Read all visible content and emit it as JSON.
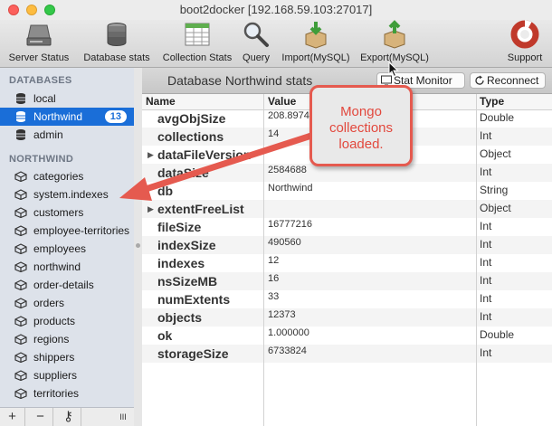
{
  "window": {
    "title": "boot2docker [192.168.59.103:27017]"
  },
  "toolbar": {
    "items": [
      {
        "label": "Server Status",
        "icon": "server-icon"
      },
      {
        "label": "Database stats",
        "icon": "database-icon"
      },
      {
        "label": "Collection Stats",
        "icon": "table-icon"
      },
      {
        "label": "Query",
        "icon": "magnifier-icon"
      },
      {
        "label": "Import(MySQL)",
        "icon": "import-box-icon"
      },
      {
        "label": "Export(MySQL)",
        "icon": "export-box-icon"
      },
      {
        "label": "Support",
        "icon": "lifebuoy-icon"
      }
    ]
  },
  "sidebar": {
    "databases_header": "DATABASES",
    "databases": [
      {
        "label": "local"
      },
      {
        "label": "Northwind",
        "badge": "13",
        "selected": true
      },
      {
        "label": "admin"
      }
    ],
    "collections_header": "NORTHWIND",
    "collections": [
      "categories",
      "system.indexes",
      "customers",
      "employee-territories",
      "employees",
      "northwind",
      "order-details",
      "orders",
      "products",
      "regions",
      "shippers",
      "suppliers",
      "territories"
    ]
  },
  "bottombar": {
    "add": "+",
    "remove": "−",
    "key": "⚷",
    "handle": "III"
  },
  "main": {
    "title": "Database Northwind stats",
    "stat_monitor_label": "Stat Monitor",
    "reconnect_label": "Reconnect",
    "columns": {
      "name": "Name",
      "value": "Value",
      "type": "Type"
    },
    "rows": [
      {
        "name": "avgObjSize",
        "value": "208.8974",
        "type": "Double"
      },
      {
        "name": "collections",
        "value": "14",
        "type": "Int"
      },
      {
        "name": "dataFileVersion",
        "value": "",
        "type": "Object",
        "expandable": true
      },
      {
        "name": "dataSize",
        "value": "2584688",
        "type": "Int"
      },
      {
        "name": "db",
        "value": "Northwind",
        "type": "String"
      },
      {
        "name": "extentFreeList",
        "value": "",
        "type": "Object",
        "expandable": true
      },
      {
        "name": "fileSize",
        "value": "16777216",
        "type": "Int"
      },
      {
        "name": "indexSize",
        "value": "490560",
        "type": "Int"
      },
      {
        "name": "indexes",
        "value": "12",
        "type": "Int"
      },
      {
        "name": "nsSizeMB",
        "value": "16",
        "type": "Int"
      },
      {
        "name": "numExtents",
        "value": "33",
        "type": "Int"
      },
      {
        "name": "objects",
        "value": "12373",
        "type": "Int"
      },
      {
        "name": "ok",
        "value": "1.000000",
        "type": "Double"
      },
      {
        "name": "storageSize",
        "value": "6733824",
        "type": "Int"
      }
    ]
  },
  "annotation": {
    "text": "Mongo collections loaded."
  },
  "colors": {
    "selection": "#1a6ed8",
    "annotation": "#e55a4f"
  }
}
